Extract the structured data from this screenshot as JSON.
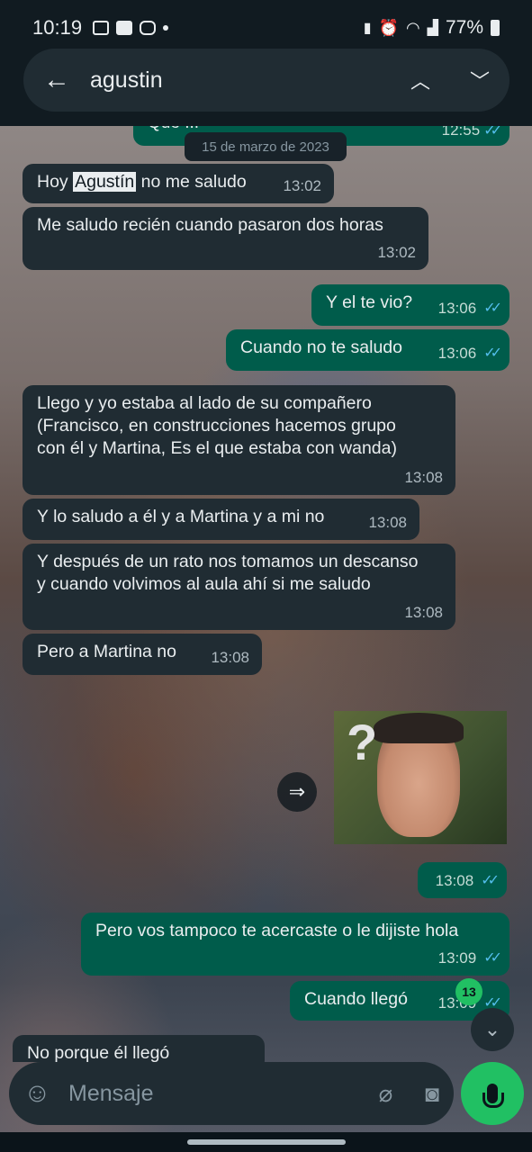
{
  "status_bar": {
    "time": "10:19",
    "battery": "77%",
    "icons": [
      "gallery-icon",
      "app-icon",
      "instagram-icon",
      "notification-dot-icon",
      "battery-saver-icon",
      "alarm-icon",
      "wifi-icon",
      "signal-icon",
      "battery-icon"
    ]
  },
  "search": {
    "query": "agustin"
  },
  "chat": {
    "partial_top": {
      "text": "Que ...",
      "time": "12:55"
    },
    "date_label": "15 de marzo de 2023",
    "messages": [
      {
        "dir": "in",
        "pre": "Hoy ",
        "match": "Agustín",
        "post": " no me saludo",
        "time": "13:02"
      },
      {
        "dir": "in",
        "text": "Me saludo recién cuando pasaron dos horas",
        "time": "13:02"
      },
      {
        "dir": "out",
        "text": "Y el te vio?",
        "time": "13:06"
      },
      {
        "dir": "out",
        "text": "Cuando no te saludo",
        "time": "13:06"
      },
      {
        "dir": "in",
        "text": "Llego y yo estaba al lado de su compañero (Francisco, en construcciones hacemos grupo con él y Martina, Es el que estaba con wanda)",
        "time": "13:08"
      },
      {
        "dir": "in",
        "text": "Y lo saludo a él y a Martina y a mi no",
        "time": "13:08"
      },
      {
        "dir": "in",
        "text": "Y después de un rato nos tomamos un descanso y cuando volvimos al aula ahí si me saludo",
        "time": "13:08"
      },
      {
        "dir": "in",
        "text": "Pero a Martina no",
        "time": "13:08"
      },
      {
        "dir": "out",
        "text": "",
        "time": "13:08"
      },
      {
        "dir": "out",
        "text": "Pero vos tampoco te acercaste o le dijiste hola",
        "time": "13:09"
      },
      {
        "dir": "out",
        "text": "Cuando llegó",
        "time": "13:09"
      },
      {
        "dir": "in",
        "text": "No porque él llegó",
        "time": ""
      }
    ],
    "unread_count": "13"
  },
  "input": {
    "placeholder": "Mensaje"
  },
  "colors": {
    "incoming": "#202c33",
    "outgoing": "#005c4b",
    "accent": "#21c063",
    "read_ticks": "#53bdeb"
  }
}
